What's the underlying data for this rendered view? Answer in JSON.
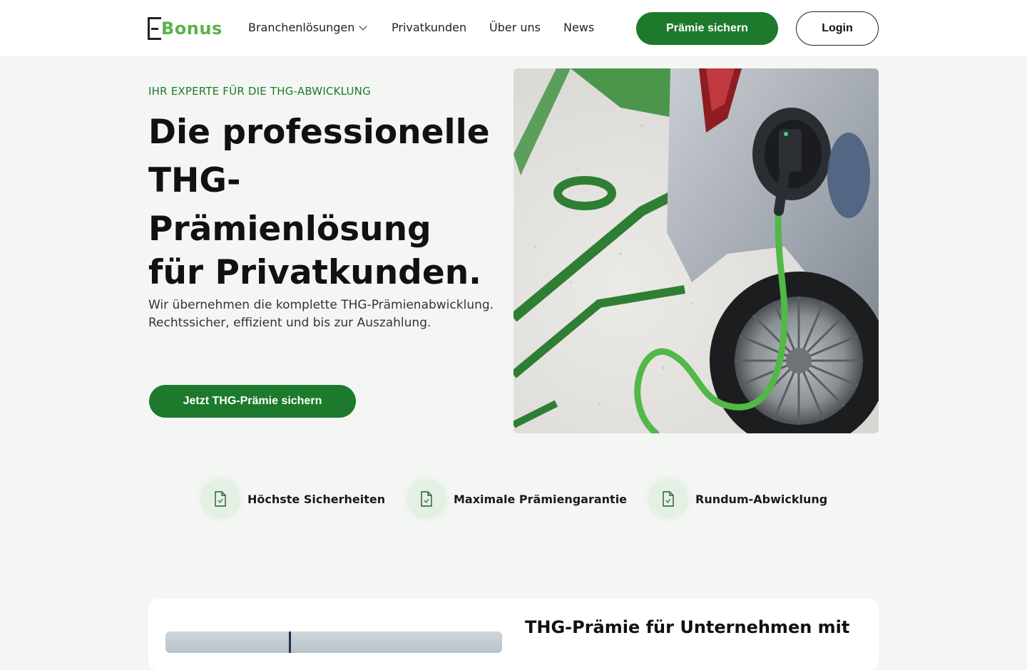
{
  "brand": {
    "logo_text": "Bonus",
    "logo_letter": "E"
  },
  "nav": {
    "items": [
      {
        "label": "Branchenlösungen",
        "has_dropdown": true
      },
      {
        "label": "Privatkunden"
      },
      {
        "label": "Über uns"
      },
      {
        "label": "News"
      }
    ],
    "primary_button": "Prämie sichern",
    "login_button": "Login"
  },
  "hero": {
    "eyebrow": "IHR EXPERTE FÜR DIE THG-ABWICKLUNG",
    "headline_lines": [
      "Die professionelle",
      "THG-",
      "Prämienlösung",
      "für Privatkunden."
    ],
    "subtext": "Wir übernehmen die komplette THG-Prämienabwicklung. Rechtssicher, effizient und bis zur Auszahlung.",
    "cta": "Jetzt THG-Prämie sichern",
    "image": "electric-car-charging-photo"
  },
  "features": [
    {
      "icon": "document-check-icon",
      "label": "Höchste Sicherheiten"
    },
    {
      "icon": "document-check-icon",
      "label": "Maximale Prämiengarantie"
    },
    {
      "icon": "document-check-icon",
      "label": "Rundum-Abwicklung"
    }
  ],
  "section_card": {
    "title": "THG-Prämie für Unternehmen mit"
  },
  "colors": {
    "brand_green": "#1d7a2c",
    "logo_green": "#5bb347",
    "page_bg": "#f4f6f4"
  }
}
